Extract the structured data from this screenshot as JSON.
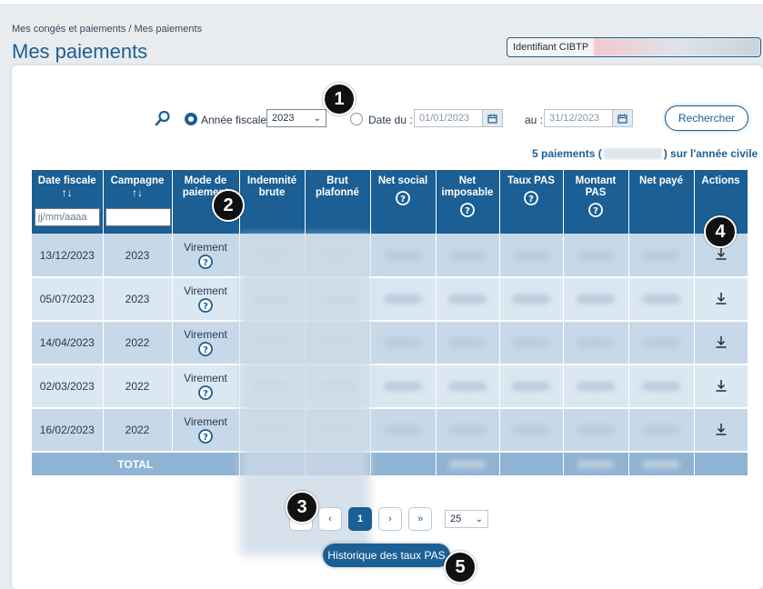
{
  "breadcrumb": "Mes congés et paiements / Mes paiements",
  "page_title": "Mes paiements",
  "cibtp": {
    "label": "Identifiant CIBTP"
  },
  "filters": {
    "annee_label": "Année fiscale",
    "year_value": "2023",
    "date_label": "Date du :",
    "date_from": "01/01/2023",
    "au_label": "au :",
    "date_to": "31/12/2023",
    "search_button": "Rechercher"
  },
  "summary": {
    "prefix": "5 paiements (",
    "suffix": ") sur l'année civile"
  },
  "table": {
    "headers": {
      "date_fiscale": "Date fiscale",
      "campagne": "Campagne",
      "mode": "Mode de paiement",
      "indemnite": "Indemnité brute",
      "brut": "Brut plafonné",
      "net_social": "Net social",
      "net_imposable": "Net imposable",
      "taux_pas": "Taux PAS",
      "montant_pas": "Montant PAS",
      "net_paye": "Net payé",
      "actions": "Actions"
    },
    "date_filter_placeholder": "jj/mm/aaaa",
    "rows": [
      {
        "date": "13/12/2023",
        "campagne": "2023",
        "mode": "Virement"
      },
      {
        "date": "05/07/2023",
        "campagne": "2023",
        "mode": "Virement"
      },
      {
        "date": "14/04/2023",
        "campagne": "2022",
        "mode": "Virement"
      },
      {
        "date": "02/03/2023",
        "campagne": "2022",
        "mode": "Virement"
      },
      {
        "date": "16/02/2023",
        "campagne": "2022",
        "mode": "Virement"
      }
    ],
    "total_label": "TOTAL"
  },
  "pagination": {
    "first": "‹",
    "prev": "‹",
    "current": "1",
    "next": "›",
    "last": "»",
    "page_size": "25"
  },
  "history_button": "Historique des taux PAS",
  "markers": [
    "1",
    "2",
    "3",
    "4",
    "5"
  ],
  "colors": {
    "primary": "#1b5f94",
    "row_odd": "#c7d9e8",
    "row_even": "#dbe7f1",
    "total_row": "#8fb3d2"
  },
  "icons": {
    "search": "search-icon",
    "calendar": "calendar-icon",
    "help": "help-icon",
    "download": "download-icon",
    "sort": "sort-icon"
  }
}
